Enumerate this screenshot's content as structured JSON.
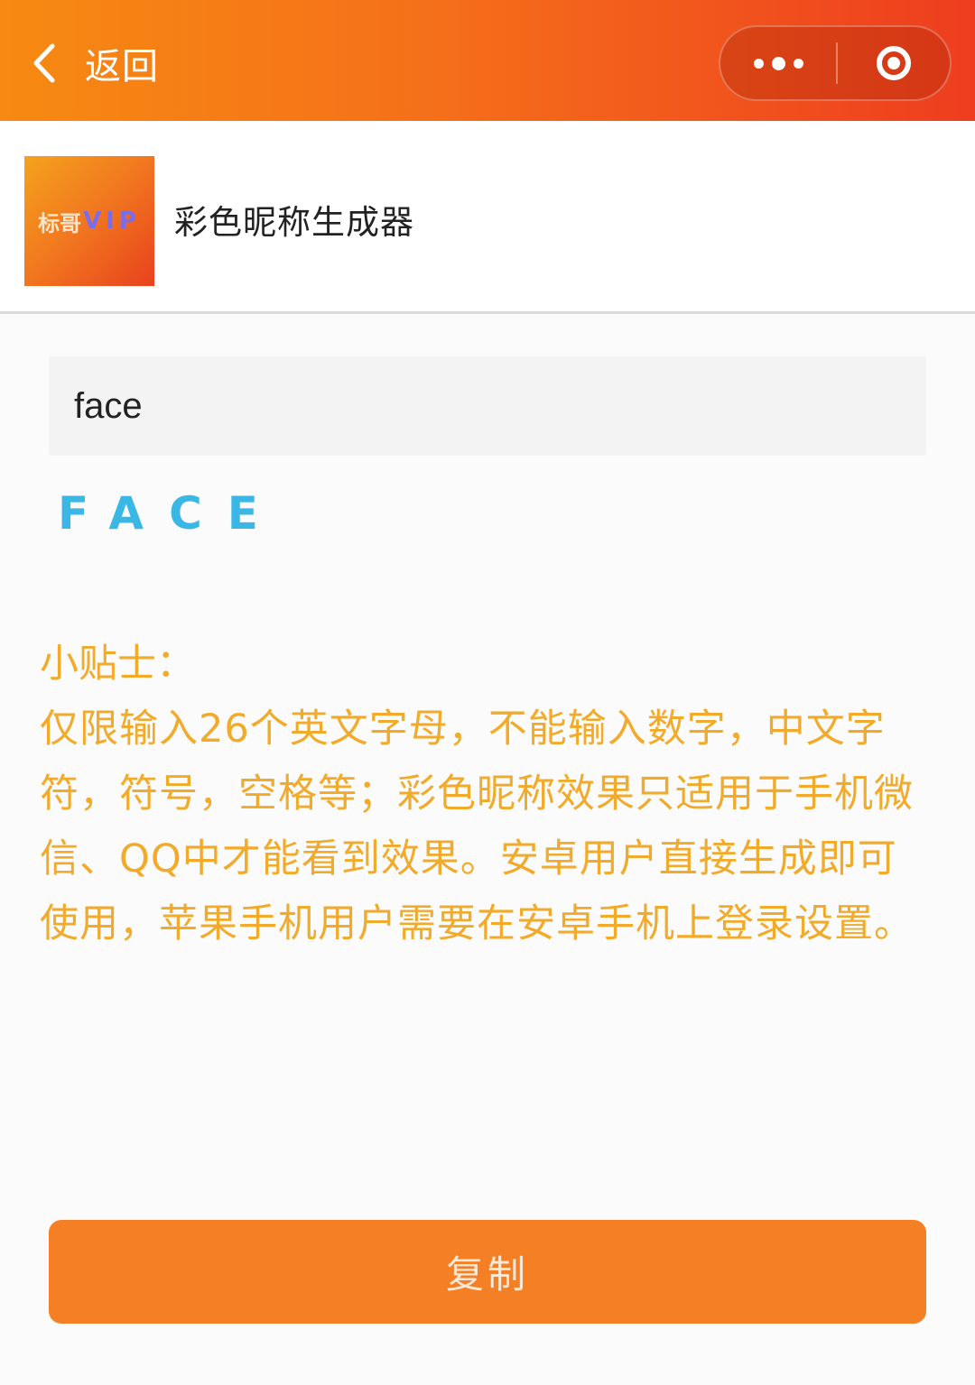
{
  "navbar": {
    "back_label": "返回",
    "more_icon": "more-dots-icon",
    "close_icon": "target-close-icon",
    "gradient": [
      "#f78a12",
      "#ee3d1f"
    ]
  },
  "app": {
    "logo_cn": "标哥",
    "logo_vip": "VIP",
    "title": "彩色昵称生成器"
  },
  "input": {
    "value": "face"
  },
  "result": {
    "text": "FACE",
    "color": "#3bb7e6"
  },
  "tips": {
    "title": "小贴士：",
    "body": "仅限输入26个英文字母，不能输入数字，中文字符，符号，空格等；彩色昵称效果只适用于手机微信、QQ中才能看到效果。安卓用户直接生成即可使用，苹果手机用户需要在安卓手机上登录设置。",
    "color": "#f2aa2a"
  },
  "actions": {
    "copy_label": "复制",
    "copy_color": "#f47f25"
  }
}
